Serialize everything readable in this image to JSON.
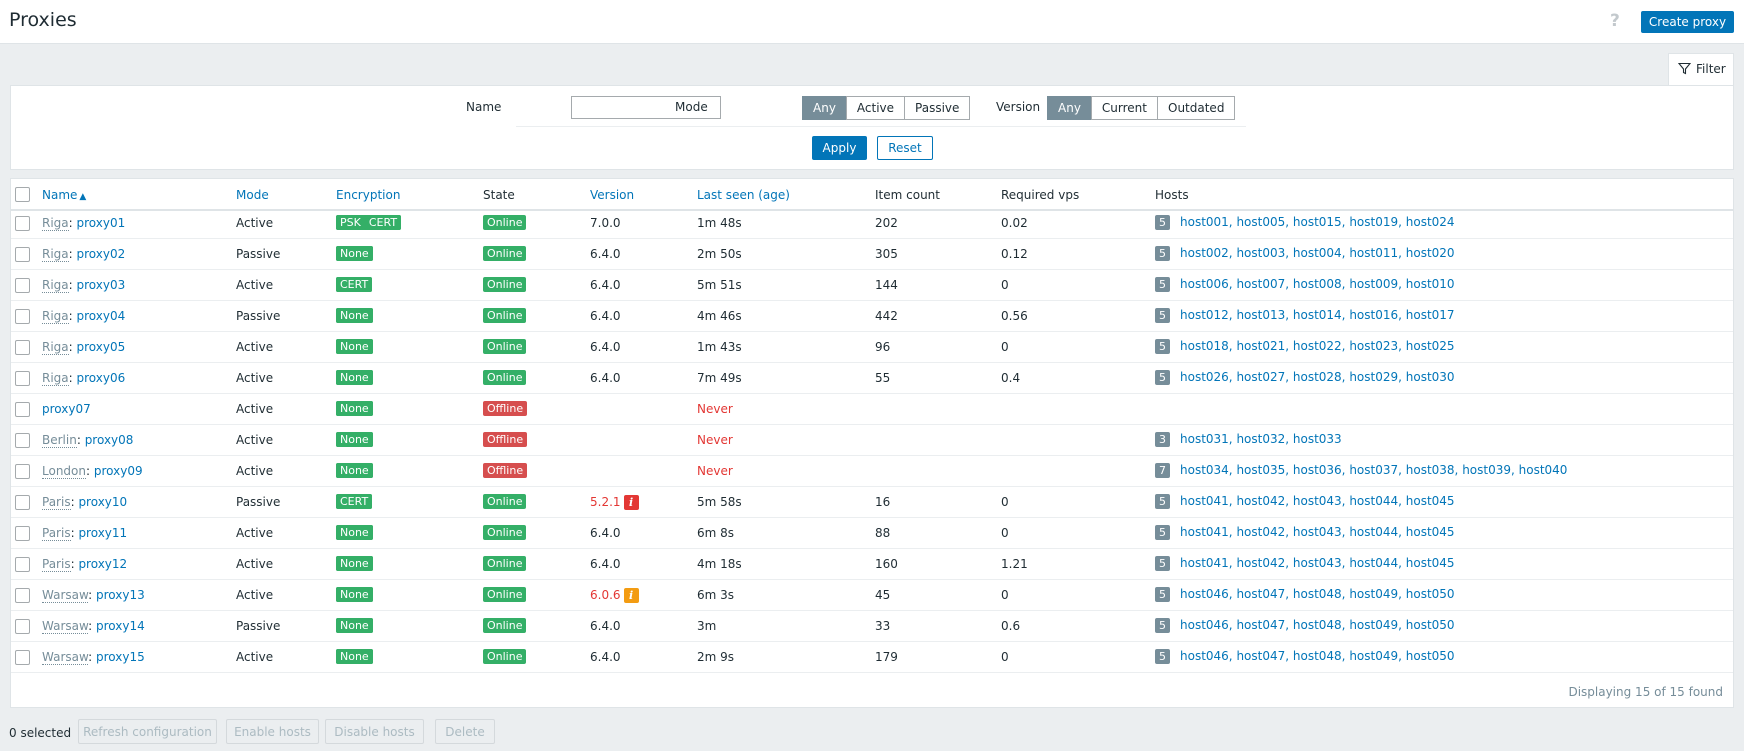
{
  "header": {
    "title": "Proxies",
    "help_icon": "?",
    "create_label": "Create proxy"
  },
  "filter_tab": {
    "label": "Filter",
    "icon": "funnel-icon"
  },
  "filter": {
    "name_label": "Name",
    "name_value": "",
    "mode_label": "Mode",
    "mode_options": [
      "Any",
      "Active",
      "Passive"
    ],
    "mode_selected": "Any",
    "version_label": "Version",
    "version_options": [
      "Any",
      "Current",
      "Outdated"
    ],
    "version_selected": "Any",
    "apply_label": "Apply",
    "reset_label": "Reset"
  },
  "table": {
    "columns": {
      "name": "Name",
      "mode": "Mode",
      "encryption": "Encryption",
      "state": "State",
      "version": "Version",
      "last_seen": "Last seen (age)",
      "item_count": "Item count",
      "required_vps": "Required vps",
      "hosts": "Hosts"
    },
    "rows": [
      {
        "loc": "Riga",
        "name": "proxy01",
        "mode": "Active",
        "enc": [
          "PSK",
          "CERT"
        ],
        "state": "Online",
        "version": "7.0.0",
        "version_warn": "",
        "last_seen": "1m 48s",
        "items": "202",
        "vps": "0.02",
        "host_count": "5",
        "hosts": "host001, host005, host015, host019, host024"
      },
      {
        "loc": "Riga",
        "name": "proxy02",
        "mode": "Passive",
        "enc": [
          "None"
        ],
        "state": "Online",
        "version": "6.4.0",
        "version_warn": "",
        "last_seen": "2m 50s",
        "items": "305",
        "vps": "0.12",
        "host_count": "5",
        "hosts": "host002, host003, host004, host011, host020"
      },
      {
        "loc": "Riga",
        "name": "proxy03",
        "mode": "Active",
        "enc": [
          "CERT"
        ],
        "state": "Online",
        "version": "6.4.0",
        "version_warn": "",
        "last_seen": "5m 51s",
        "items": "144",
        "vps": "0",
        "host_count": "5",
        "hosts": "host006, host007, host008, host009, host010"
      },
      {
        "loc": "Riga",
        "name": "proxy04",
        "mode": "Passive",
        "enc": [
          "None"
        ],
        "state": "Online",
        "version": "6.4.0",
        "version_warn": "",
        "last_seen": "4m 46s",
        "items": "442",
        "vps": "0.56",
        "host_count": "5",
        "hosts": "host012, host013, host014, host016, host017"
      },
      {
        "loc": "Riga",
        "name": "proxy05",
        "mode": "Active",
        "enc": [
          "None"
        ],
        "state": "Online",
        "version": "6.4.0",
        "version_warn": "",
        "last_seen": "1m 43s",
        "items": "96",
        "vps": "0",
        "host_count": "5",
        "hosts": "host018, host021, host022, host023, host025"
      },
      {
        "loc": "Riga",
        "name": "proxy06",
        "mode": "Active",
        "enc": [
          "None"
        ],
        "state": "Online",
        "version": "6.4.0",
        "version_warn": "",
        "last_seen": "7m 49s",
        "items": "55",
        "vps": "0.4",
        "host_count": "5",
        "hosts": "host026, host027, host028, host029, host030"
      },
      {
        "loc": "",
        "name": "proxy07",
        "mode": "Active",
        "enc": [
          "None"
        ],
        "state": "Offline",
        "version": "",
        "version_warn": "",
        "last_seen": "Never",
        "items": "",
        "vps": "",
        "host_count": "",
        "hosts": ""
      },
      {
        "loc": "Berlin",
        "name": "proxy08",
        "mode": "Active",
        "enc": [
          "None"
        ],
        "state": "Offline",
        "version": "",
        "version_warn": "",
        "last_seen": "Never",
        "items": "",
        "vps": "",
        "host_count": "3",
        "hosts": "host031, host032, host033"
      },
      {
        "loc": "London",
        "name": "proxy09",
        "mode": "Active",
        "enc": [
          "None"
        ],
        "state": "Offline",
        "version": "",
        "version_warn": "",
        "last_seen": "Never",
        "items": "",
        "vps": "",
        "host_count": "7",
        "hosts": "host034, host035, host036, host037, host038, host039, host040"
      },
      {
        "loc": "Paris",
        "name": "proxy10",
        "mode": "Passive",
        "enc": [
          "CERT"
        ],
        "state": "Online",
        "version": "5.2.1",
        "version_warn": "red",
        "last_seen": "5m 58s",
        "items": "16",
        "vps": "0",
        "host_count": "5",
        "hosts": "host041, host042, host043, host044, host045"
      },
      {
        "loc": "Paris",
        "name": "proxy11",
        "mode": "Active",
        "enc": [
          "None"
        ],
        "state": "Online",
        "version": "6.4.0",
        "version_warn": "",
        "last_seen": "6m 8s",
        "items": "88",
        "vps": "0",
        "host_count": "5",
        "hosts": "host041, host042, host043, host044, host045"
      },
      {
        "loc": "Paris",
        "name": "proxy12",
        "mode": "Active",
        "enc": [
          "None"
        ],
        "state": "Online",
        "version": "6.4.0",
        "version_warn": "",
        "last_seen": "4m 18s",
        "items": "160",
        "vps": "1.21",
        "host_count": "5",
        "hosts": "host041, host042, host043, host044, host045"
      },
      {
        "loc": "Warsaw",
        "name": "proxy13",
        "mode": "Active",
        "enc": [
          "None"
        ],
        "state": "Online",
        "version": "6.0.6",
        "version_warn": "orange",
        "last_seen": "6m 3s",
        "items": "45",
        "vps": "0",
        "host_count": "5",
        "hosts": "host046, host047, host048, host049, host050"
      },
      {
        "loc": "Warsaw",
        "name": "proxy14",
        "mode": "Passive",
        "enc": [
          "None"
        ],
        "state": "Online",
        "version": "6.4.0",
        "version_warn": "",
        "last_seen": "3m",
        "items": "33",
        "vps": "0.6",
        "host_count": "5",
        "hosts": "host046, host047, host048, host049, host050"
      },
      {
        "loc": "Warsaw",
        "name": "proxy15",
        "mode": "Active",
        "enc": [
          "None"
        ],
        "state": "Online",
        "version": "6.4.0",
        "version_warn": "",
        "last_seen": "2m 9s",
        "items": "179",
        "vps": "0",
        "host_count": "5",
        "hosts": "host046, host047, host048, host049, host050"
      }
    ],
    "footer": "Displaying 15 of 15 found"
  },
  "actions": {
    "selected": "0 selected",
    "buttons": [
      "Refresh configuration",
      "Enable hosts",
      "Disable hosts",
      "Delete"
    ]
  },
  "colors": {
    "accent": "#0275b8",
    "online": "#34af67",
    "offline": "#d64e4e",
    "warn_red": "#e33734",
    "warn_orange": "#f39c12"
  }
}
